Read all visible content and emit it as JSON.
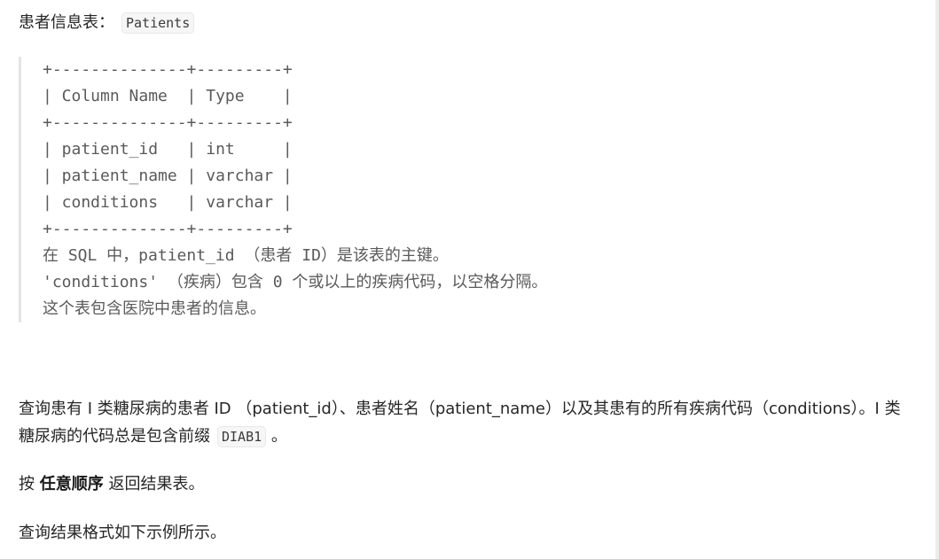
{
  "heading": {
    "label": "患者信息表：",
    "table_name": "Patients"
  },
  "schema_block": {
    "lines": [
      "+--------------+---------+",
      "| Column Name  | Type    |",
      "+--------------+---------+",
      "| patient_id   | int     |",
      "| patient_name | varchar |",
      "| conditions   | varchar |",
      "+--------------+---------+"
    ],
    "notes": [
      "在 SQL 中，patient_id （患者 ID）是该表的主键。",
      "'conditions' （疾病）包含 0 个或以上的疾病代码，以空格分隔。",
      "这个表包含医院中患者的信息。"
    ]
  },
  "question": {
    "text_before_code": "查询患有 I 类糖尿病的患者 ID （patient_id）、患者姓名（patient_name）以及其患有的所有疾病代码（conditions）。I 类糖尿病的代码总是包含前缀",
    "code": "DIAB1",
    "text_after_code": "。"
  },
  "order_line": {
    "prefix": "按 ",
    "bold": "任意顺序",
    "suffix": " 返回结果表。"
  },
  "format_line": "查询结果格式如下示例所示。"
}
